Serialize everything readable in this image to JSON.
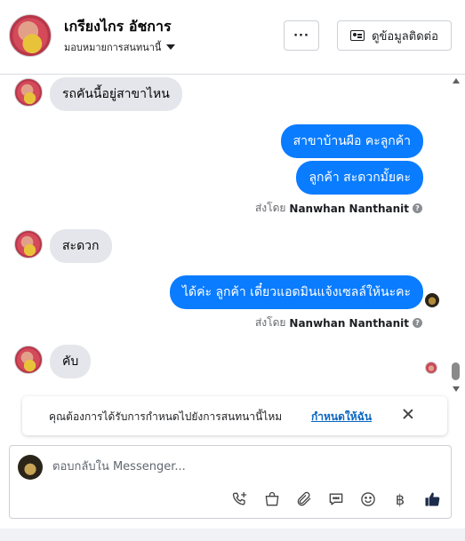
{
  "header": {
    "contact_name": "เกรียงไกร อัชการ",
    "assign_label": "มอบหมายการสนทนานี้",
    "more_label": "···",
    "contact_info_label": "ดูข้อมูลติดต่อ"
  },
  "messages": [
    {
      "direction": "in",
      "text": "รถคันนี้อยู่สาขาไหน"
    },
    {
      "direction": "out",
      "text": "สาขาบ้านผือ คะลูกค้า"
    },
    {
      "direction": "out",
      "text": "ลูกค้า สะดวกมั้ยคะ"
    },
    {
      "direction": "in",
      "text": "สะดวก"
    },
    {
      "direction": "out",
      "text": "ได้ค่ะ  ลูกค้า  เดี๋ยวแอดมินแจ้งเซลล์ให้นะคะ"
    },
    {
      "direction": "in",
      "text": "คับ"
    }
  ],
  "sent_by": {
    "prefix": "ส่งโดย",
    "agent_name": "Nanwhan Nanthanit",
    "help_icon": "?"
  },
  "assign_banner": {
    "text": "คุณต้องการได้รับการกำหนดไปยังการสนทนานี้ไหม",
    "link": "กำหนดให้ฉัน"
  },
  "composer": {
    "placeholder": "ตอบกลับใน Messenger...",
    "tools": [
      "phone-plus-icon",
      "shopping-bag-icon",
      "paperclip-icon",
      "chat-bubble-icon",
      "smiley-icon",
      "baht-icon",
      "thumbs-up-icon"
    ],
    "baht_symbol": "฿"
  },
  "colors": {
    "outgoing_bubble": "#0a7cff",
    "incoming_bubble": "#e4e6eb",
    "link": "#0a66c2",
    "like": "#1c2b4a"
  }
}
